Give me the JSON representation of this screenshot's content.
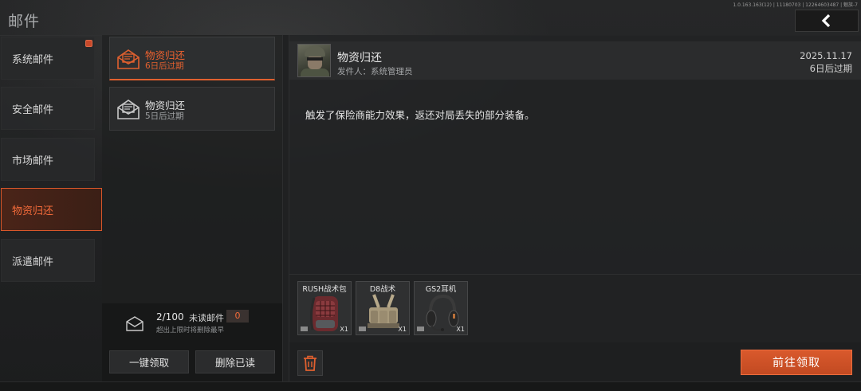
{
  "header": {
    "title": "邮件",
    "version_text": "1.0.163.163(12) | 11180703 | 12264603487 | 魅族-7",
    "back_icon": "chevron-left-icon"
  },
  "categories": [
    {
      "label": "系统邮件",
      "has_badge": true,
      "active": false
    },
    {
      "label": "安全邮件",
      "has_badge": false,
      "active": false
    },
    {
      "label": "市场邮件",
      "has_badge": false,
      "active": false
    },
    {
      "label": "物资归还",
      "has_badge": false,
      "active": true
    },
    {
      "label": "派遣邮件",
      "has_badge": false,
      "active": false
    }
  ],
  "mails": [
    {
      "title": "物资归还",
      "subtitle": "6日后过期",
      "icon": "open-envelope-icon",
      "active": true
    },
    {
      "title": "物资归还",
      "subtitle": "5日后过期",
      "icon": "open-envelope-icon",
      "active": false
    }
  ],
  "mailbox": {
    "count": "2/100",
    "unread_label": "未读邮件",
    "unread_count": "0",
    "limit_note": "超出上限时将删除最早",
    "claim_all_label": "一键领取",
    "delete_read_label": "删除已读"
  },
  "detail": {
    "title": "物资归还",
    "sender": "发件人：系统管理员",
    "date": "2025.11.17",
    "expire": "6日后过期",
    "body": "触发了保险商能力效果，返还对局丢失的部分装备。",
    "items": [
      {
        "name": "RUSH战术包",
        "qty": "X1",
        "icon": "backpack-icon"
      },
      {
        "name": "D8战术",
        "qty": "X1",
        "icon": "chest-rig-icon"
      },
      {
        "name": "GS2耳机",
        "qty": "X1",
        "icon": "headset-icon"
      }
    ],
    "delete_icon": "trash-icon",
    "claim_label": "前往领取"
  },
  "colors": {
    "accent": "#e0602f",
    "accent_text": "#f26a3a",
    "background": "#1b1c1d"
  }
}
